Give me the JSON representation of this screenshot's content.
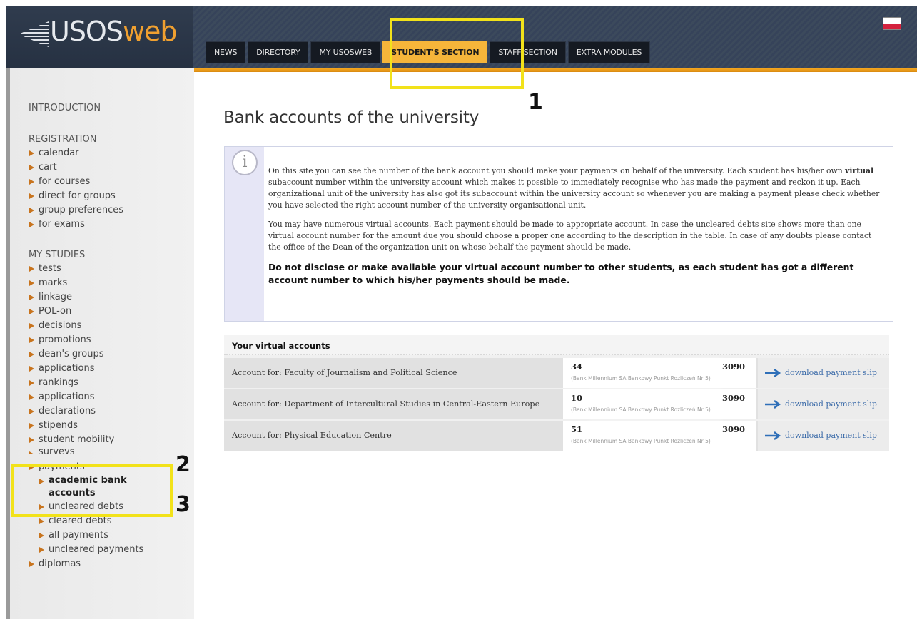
{
  "logo": {
    "prefix": "USOS",
    "suffix": "web"
  },
  "tabs": [
    {
      "label": "NEWS"
    },
    {
      "label": "DIRECTORY"
    },
    {
      "label": "MY USOSWEB"
    },
    {
      "label": "STUDENT'S SECTION"
    },
    {
      "label": "STAFF SECTION"
    },
    {
      "label": "EXTRA MODULES"
    }
  ],
  "active_tab": "STUDENT'S SECTION",
  "annotations": [
    "1",
    "2",
    "3"
  ],
  "sidebar": {
    "introduction": "INTRODUCTION",
    "registration": {
      "title": "REGISTRATION",
      "items": [
        "calendar",
        "cart",
        "for courses",
        "direct for groups",
        "group preferences",
        "for exams"
      ]
    },
    "my_studies": {
      "title": "MY STUDIES",
      "items": [
        "tests",
        "marks",
        "linkage",
        "POL-on",
        "decisions",
        "promotions",
        "dean's groups",
        "applications",
        "rankings",
        "applications",
        "declarations",
        "stipends",
        "student mobility",
        "surveys",
        "payments"
      ],
      "payments_sub": [
        "academic bank accounts",
        "uncleared debts",
        "cleared debts",
        "all payments",
        "uncleared payments"
      ],
      "after": [
        "diplomas"
      ]
    }
  },
  "main": {
    "title": "Bank accounts of the university",
    "info": {
      "p1_before": "On this site you can see the number of the bank account you should make your payments on behalf of the university. Each student has his/her own ",
      "p1_bold": "virtual",
      "p1_after": " subaccount number within the university account which makes it possible to immediately recognise who has made the payment and reckon it up. Each organizational unit of the university has also got its subaccount within the university account so whenever you are making a payment please check whether you have selected the right account number of the university organisational unit.",
      "p2": "You may have numerous virtual accounts. Each payment should be made to appropriate account. In case the uncleared debts site shows more than one virtual account number for the amount due you should choose a proper one according to the description in the table. In case of any doubts please contact the office of the Dean of the organization unit on whose behalf the payment should be made.",
      "p3": "Do not disclose or make available your virtual account number to other students, as each student has got a different account number to which his/her payments should be made."
    },
    "accounts": {
      "header": "Your virtual accounts",
      "rows": [
        {
          "label": "Account for: Faculty of Journalism and Political Science",
          "number_start": "34",
          "number_end": "3090",
          "bank": "(Bank Millennium SA Bankowy Punkt Rozliczeń Nr 5)",
          "download": "download payment slip"
        },
        {
          "label": "Account for: Department of Intercultural Studies in Central-Eastern Europe",
          "number_start": "10",
          "number_end": "3090",
          "bank": "(Bank Millennium SA Bankowy Punkt Rozliczeń Nr 5)",
          "download": "download payment slip"
        },
        {
          "label": "Account for: Physical Education Centre",
          "number_start": "51",
          "number_end": "3090",
          "bank": "(Bank Millennium SA Bankowy Punkt Rozliczeń Nr 5)",
          "download": "download payment slip"
        }
      ]
    }
  },
  "colors": {
    "accent": "#f6b53a",
    "highlight": "#f2e21a",
    "link": "#3a6aa8",
    "bullet": "#c8741e"
  },
  "icons": {
    "info": "info-icon",
    "flag": "polish-flag-icon",
    "arrow": "arrow-right-icon",
    "bullet": "triangle-bullet-icon"
  }
}
